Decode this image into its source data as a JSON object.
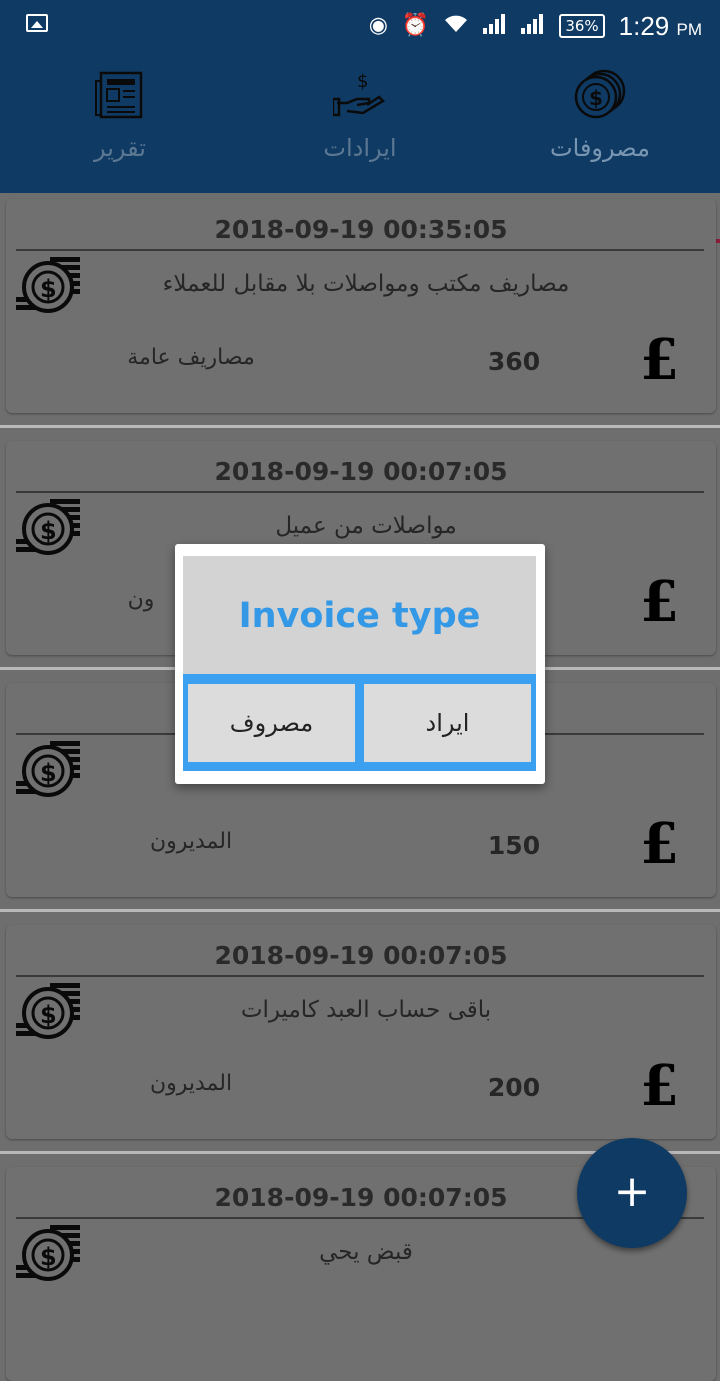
{
  "status_bar": {
    "battery": "36%",
    "time": "1:29",
    "ampm": "PM"
  },
  "tabs": [
    {
      "label": "تقرير",
      "icon": "report-icon"
    },
    {
      "label": "ايرادات",
      "icon": "income-icon"
    },
    {
      "label": "مصروفات",
      "icon": "coins-icon",
      "active": true
    }
  ],
  "entries": [
    {
      "date": "2018-09-19 00:35:05",
      "description": "مصاريف مكتب ومواصلات بلا مقابل للعملاء",
      "amount": "360",
      "category": "مصاريف عامة"
    },
    {
      "date": "2018-09-19 00:07:05",
      "description": "مواصلات من عميل",
      "amount": "",
      "category": "ون"
    },
    {
      "date": "",
      "description": "",
      "amount": "150",
      "category": "المديرون"
    },
    {
      "date": "2018-09-19 00:07:05",
      "description": "باقى حساب العبد كاميرات",
      "amount": "200",
      "category": "المديرون"
    },
    {
      "date": "2018-09-19 00:07:05",
      "description": "قبض يحي",
      "amount": "",
      "category": ""
    }
  ],
  "currency_symbol": "£",
  "fab": {
    "label": "+"
  },
  "dialog": {
    "title": "Invoice type",
    "left_button": "مصروف",
    "right_button": "ايراد"
  },
  "colors": {
    "primary": "#0f3a63",
    "accent": "#8d1d3a",
    "dialog_title": "#3398e6",
    "dialog_button_frame": "#3aa0ef"
  }
}
